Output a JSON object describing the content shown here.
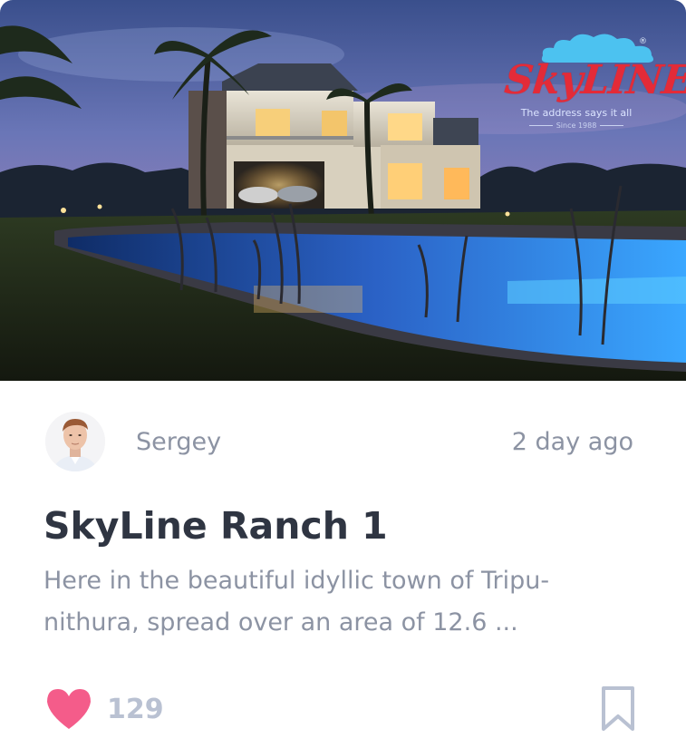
{
  "card": {
    "image": {
      "logo": {
        "brand": "SkyLINE",
        "reg_mark": "®",
        "tagline": "The address says it all",
        "since": "Since 1988"
      }
    },
    "author": "Sergey",
    "time_ago": "2 day ago",
    "title": "SkyLine Ranch 1",
    "description": "Here in the beautiful idyllic town of Tripu-nithura, spread over an area of 12.6 ...",
    "likes": "129",
    "colors": {
      "heart": "#f45c8a",
      "bookmark": "#b9c1d2",
      "title": "#2f3542",
      "muted": "#8c93a3",
      "logo": "#e32b38"
    },
    "icons": [
      "heart-icon",
      "bookmark-icon"
    ]
  }
}
